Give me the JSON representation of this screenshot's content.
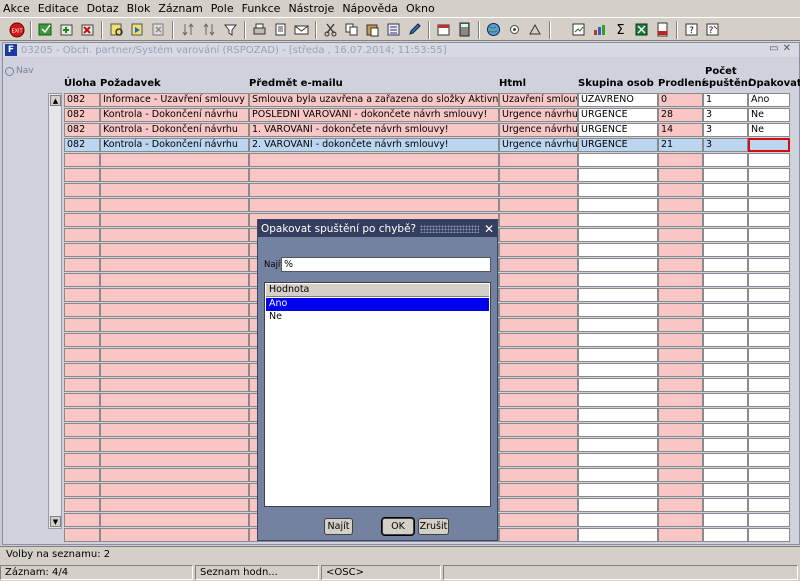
{
  "menu": [
    "Akce",
    "Editace",
    "Dotaz",
    "Blok",
    "Záznam",
    "Pole",
    "Funkce",
    "Nástroje",
    "Nápověda",
    "Okno"
  ],
  "window": {
    "icon_label": "F",
    "title": "03205 - Obch. partner/Systém varování (RSPOZAD) - [středa , 16.07.2014; 11:53:55]",
    "nav_label": "Nav"
  },
  "columns": {
    "uloha": "Úloha",
    "pozadavek": "Požadavek",
    "predmet": "Předmět e-mailu",
    "html": "Html",
    "skupina": "Skupina osob",
    "prodleni": "Prodlení",
    "pocet_1": "Počet",
    "pocet_2": "spuštění",
    "opakovat": "Opakovat"
  },
  "rows": [
    {
      "uloha": "082",
      "pozadavek": "Informace - Uzavření smlouvy",
      "predmet": "Smlouva byla uzavřena a zařazena do složky Aktivní",
      "html": "Uzavření smlouvy",
      "skupina": "UZAVRENO",
      "prodleni": "0",
      "pocet": "1",
      "opakovat": "Ano"
    },
    {
      "uloha": "082",
      "pozadavek": "Kontrola - Dokončení návrhu",
      "predmet": "POSLEDNÍ VAROVÁNÍ - dokončete návrh smlouvy!",
      "html": "Urgence návrhu",
      "skupina": "URGENCE",
      "prodleni": "28",
      "pocet": "3",
      "opakovat": "Ne"
    },
    {
      "uloha": "082",
      "pozadavek": "Kontrola - Dokončení návrhu",
      "predmet": "1. VAROVÁNÍ - dokončete návrh smlouvy!",
      "html": "Urgence návrhu",
      "skupina": "URGENCE",
      "prodleni": "14",
      "pocet": "3",
      "opakovat": "Ne"
    },
    {
      "uloha": "082",
      "pozadavek": "Kontrola - Dokončení návrhu",
      "predmet": "2. VAROVÁNÍ - dokončete návrh smlouvy!",
      "html": "Urgence návrhu",
      "skupina": "URGENCE",
      "prodleni": "21",
      "pocet": "3",
      "opakovat": ""
    }
  ],
  "dialog": {
    "title": "Opakovat spuštění po chybě?",
    "close": "✕",
    "find_label": "Najít",
    "find_value": "%",
    "list_header": "Hodnota",
    "options": [
      "Ano",
      "Ne"
    ],
    "btn_find": "Najít",
    "btn_ok": "OK",
    "btn_cancel": "Zrušit"
  },
  "status": {
    "line1": "Volby na seznamu: 2",
    "record": "Záznam: 4/4",
    "list": "Seznam hodn...",
    "osc": "<OSC>"
  },
  "toolbar_icons": [
    "exit-icon",
    "save-icon",
    "insert-record-icon",
    "delete-record-icon",
    "query-icon",
    "execute-query-icon",
    "cancel-query-icon",
    "sort-icon",
    "sort-desc-icon",
    "filter-icon",
    "print-icon",
    "print-preview-icon",
    "mail-icon",
    "cut-icon",
    "copy-icon",
    "paste-icon",
    "list-icon",
    "edit-icon",
    "calendar-icon",
    "calculator-icon",
    "world-icon",
    "weather-icon",
    "abc-icon",
    "report-icon",
    "chart-icon",
    "sum-icon",
    "excel-icon",
    "pdf-icon",
    "help-icon",
    "find-help-icon"
  ],
  "colors": {
    "pink": "#f9c6c6",
    "selected": "#bcd6f2",
    "dialog": "#7482a2",
    "focus_border": "#d01010"
  }
}
